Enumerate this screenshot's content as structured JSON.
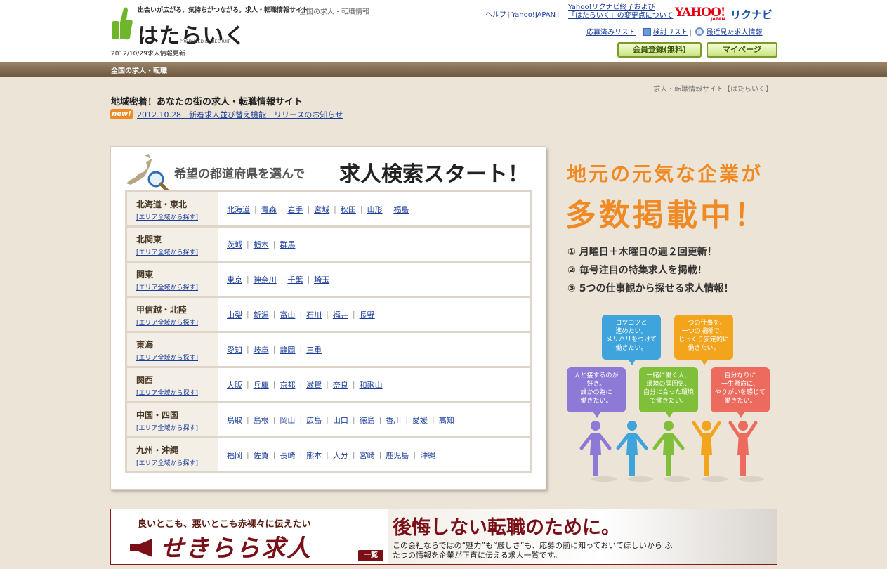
{
  "header": {
    "tagline": "出会いが広がる、気持ちがつながる。求人・転職情報サイト",
    "logo_text": "はたらいく",
    "produced_by": "PRODUCED BY RECRUIT",
    "updated": "2012/10/29求人情報更新",
    "site_desc": "全国の求人・転職情報",
    "links": {
      "help": "ヘルプ",
      "yahoo_japan": "Yahoo!JAPAN",
      "notice_line1": "Yahoo!リクナビ終了および",
      "notice_line2": "「はたらいく」の変更点について",
      "applied_list": "応募済みリスト",
      "saved_list": "検討リスト",
      "recent_jobs": "最近見た求人情報"
    },
    "yahoo_logo": "YAHOO!",
    "yahoo_japan_small": "JAPAN",
    "rikunabi_logo": "リクナビ",
    "member_register": "会員登録(無料)",
    "mypage": "マイページ"
  },
  "nav": {
    "title": "全国の求人・転職"
  },
  "breadcrumb": "求人・転職情報サイト【はたらいく】",
  "page_title": "地域密着！あなたの街の求人・転職情報サイト",
  "news": {
    "badge": "new!",
    "text": "2012.10.28　新着求人並び替え機能　リリースのお知らせ"
  },
  "search": {
    "sub_heading": "希望の都道府県を選んで",
    "main_heading": "求人検索スタート！",
    "all_area_label": "[エリア全域から探す]",
    "regions": [
      {
        "name": "北海道・東北",
        "prefs": [
          "北海道",
          "青森",
          "岩手",
          "宮城",
          "秋田",
          "山形",
          "福島"
        ]
      },
      {
        "name": "北関東",
        "prefs": [
          "茨城",
          "栃木",
          "群馬"
        ]
      },
      {
        "name": "関東",
        "prefs": [
          "東京",
          "神奈川",
          "千葉",
          "埼玉"
        ]
      },
      {
        "name": "甲信越・北陸",
        "prefs": [
          "山梨",
          "新潟",
          "富山",
          "石川",
          "福井",
          "長野"
        ]
      },
      {
        "name": "東海",
        "prefs": [
          "愛知",
          "岐阜",
          "静岡",
          "三重"
        ]
      },
      {
        "name": "関西",
        "prefs": [
          "大阪",
          "兵庫",
          "京都",
          "滋賀",
          "奈良",
          "和歌山"
        ]
      },
      {
        "name": "中国・四国",
        "prefs": [
          "鳥取",
          "島根",
          "岡山",
          "広島",
          "山口",
          "徳島",
          "香川",
          "愛媛",
          "高知"
        ]
      },
      {
        "name": "九州・沖縄",
        "prefs": [
          "福岡",
          "佐賀",
          "長崎",
          "熊本",
          "大分",
          "宮崎",
          "鹿児島",
          "沖縄"
        ]
      }
    ]
  },
  "promo": {
    "title1": "地元の元気な企業が",
    "title2": "多数掲載中！",
    "points": [
      "① 月曜日＋木曜日の週２回更新！",
      "② 毎号注目の特集求人を掲載！",
      "③ 5つの仕事観から探せる求人情報！"
    ],
    "bubbles": [
      {
        "text": "コツコツと\n進めたい。\nメリハリをつけて\n働きたい。",
        "color": "#3fa3dc"
      },
      {
        "text": "一つの仕事を、\n一つの場所で、\nじっくり安定的に\n働きたい。",
        "color": "#f2a51c"
      },
      {
        "text": "人と接するのが\n好き。\n誰かの為に\n働きたい。",
        "color": "#8c7ad6"
      },
      {
        "text": "一緒に働く人、\n環境の雰囲気、\n自分に合った環境\nで働きたい。",
        "color": "#7fbf3a"
      },
      {
        "text": "自分なりに\n一生懸命に、\nやりがいを感じて\n働きたい。",
        "color": "#ec6a5e"
      }
    ],
    "figure_colors": [
      "#8c7ad6",
      "#3fa3dc",
      "#7fbf3a",
      "#f2a51c",
      "#ec6a5e"
    ]
  },
  "banner": {
    "catch": "良いとこも、悪いとこも赤裸々に伝えたい",
    "brand": "せきらら求人",
    "button": "一覧",
    "headline": "後悔しない転職のために。",
    "desc": "この会社ならではの“魅力”も“厳しさ”も、応募の前に知っておいてほしいから ふたつの情報を企業が正直に伝える求人一覧です。"
  }
}
